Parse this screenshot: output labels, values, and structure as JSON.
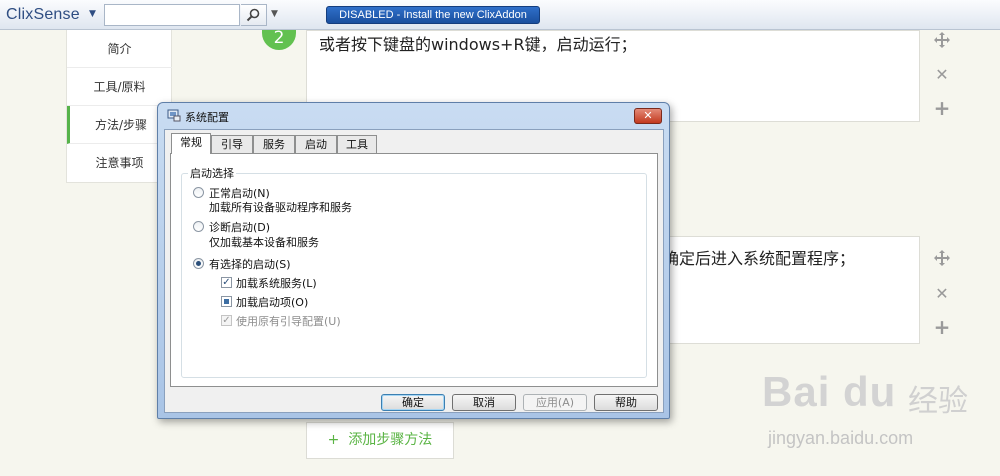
{
  "toolbar": {
    "logo": "ClixSense",
    "search": {
      "value": "",
      "placeholder": ""
    },
    "addon_button": "DISABLED - Install the new ClixAddon"
  },
  "left_nav": {
    "items": [
      {
        "label": "简介"
      },
      {
        "label": "工具/原料"
      },
      {
        "label": "方法/步骤",
        "active": true
      },
      {
        "label": "注意事项"
      }
    ]
  },
  "steps": {
    "step1": {
      "number": "2",
      "text": "或者按下键盘的windows+R键，启动运行；"
    },
    "step2": {
      "text": "击确定后进入系统配置程序；"
    }
  },
  "add_step_button": "添加步骤方法",
  "dialog": {
    "title": "系统配置",
    "close_label": "✕",
    "tabs": [
      "常规",
      "引导",
      "服务",
      "启动",
      "工具"
    ],
    "active_tab": "常规",
    "group_label": "启动选择",
    "options": [
      {
        "label": "正常启动(N)",
        "description": "加载所有设备驱动程序和服务",
        "checked": false
      },
      {
        "label": "诊断启动(D)",
        "description": "仅加载基本设备和服务",
        "checked": false
      },
      {
        "label": "有选择的启动(S)",
        "checked": true
      }
    ],
    "checks": [
      {
        "label": "加载系统服务(L)",
        "state": "checked"
      },
      {
        "label": "加载启动项(O)",
        "state": "indeterminate"
      },
      {
        "label": "使用原有引导配置(U)",
        "state": "checked-disabled"
      }
    ],
    "buttons": {
      "ok": "确定",
      "cancel": "取消",
      "apply": "应用(A)",
      "help": "帮助"
    }
  },
  "watermark": {
    "brand": "Bai du",
    "cn": "经验",
    "url": "jingyan.baidu.com"
  },
  "colors": {
    "accent_green": "#62c150",
    "addon_blue": "#1a4f9e"
  }
}
